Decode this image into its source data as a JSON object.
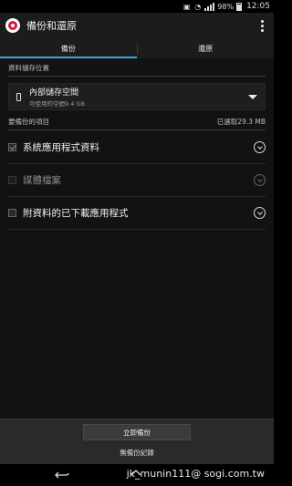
{
  "status_bar": {
    "battery": "98%",
    "time": "12:05",
    "icons": [
      "media-icon",
      "wifi-icon",
      "signal-icon",
      "battery-icon"
    ]
  },
  "app_bar": {
    "title": "備份和還原",
    "logo_color": "#d71a3a"
  },
  "tabs": [
    {
      "label": "備份",
      "active": true
    },
    {
      "label": "還原",
      "active": false
    }
  ],
  "storage_section": {
    "header": "資料儲存位置",
    "location_name": "內部儲存空間",
    "available": "可使用的空間9.4 GB"
  },
  "backup_items_section": {
    "header": "要備份的項目",
    "selected_size": "已選取29.3 MB",
    "items": [
      {
        "label": "系統應用程式資料",
        "checked": true,
        "enabled": true
      },
      {
        "label": "媒體檔案",
        "checked": false,
        "enabled": false
      },
      {
        "label": "附資料的已下載應用程式",
        "checked": false,
        "enabled": true
      }
    ]
  },
  "bottom": {
    "backup_now_label": "立即備份",
    "no_record_label": "無備份記錄"
  },
  "watermark": "jk_munin111@ sogi.com.tw",
  "colors": {
    "accent": "#3aa6d8",
    "background": "#121212"
  }
}
